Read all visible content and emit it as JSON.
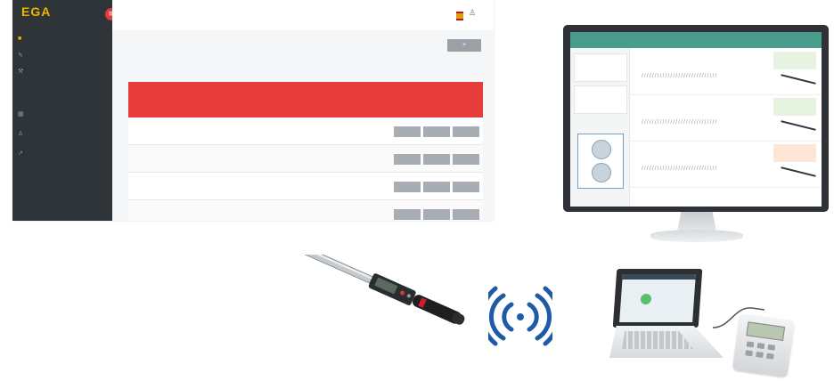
{
  "webapp": {
    "logo_line1": "EGA",
    "logo_line2": "",
    "badge": "≡",
    "nav": [
      {
        "label": "",
        "icon": "dashboard-icon"
      },
      {
        "label": "",
        "icon": "wrench-icon"
      },
      {
        "label": "",
        "icon": "tools-icon"
      }
    ],
    "nav_section": "",
    "nav_section_items": [
      {
        "label": "",
        "icon": "calendar-icon"
      },
      {
        "label": "",
        "icon": "user-icon"
      },
      {
        "label": "",
        "icon": "chart-icon"
      }
    ],
    "user_name": "",
    "add_button": "+",
    "crumb": "",
    "crumb_right": "",
    "table": {
      "headers": [
        "",
        "",
        "",
        "",
        ""
      ],
      "rows": [
        {
          "id": "",
          "status": "",
          "date": "",
          "buttons": [
            "",
            "",
            ""
          ]
        },
        {
          "id": "",
          "status": "",
          "date": "",
          "buttons": [
            "",
            "",
            ""
          ]
        },
        {
          "id": "",
          "status": "",
          "date": "",
          "buttons": [
            "",
            "",
            ""
          ]
        },
        {
          "id": "",
          "status": "",
          "date": "",
          "buttons": [
            "",
            "",
            ""
          ]
        }
      ]
    },
    "colors": {
      "sidebar": "#2f3438",
      "table_header": "#e73c3c",
      "logo": "#f0b400"
    }
  },
  "monitor": {
    "title": "",
    "right": "",
    "cards": [
      {
        "k": "",
        "v": ""
      },
      {
        "k": "",
        "v": ""
      }
    ],
    "card_label": "",
    "rows": [
      {
        "code": "",
        "label": "",
        "val": "",
        "tag": "",
        "tag_color": "#e6f3e0"
      },
      {
        "code": "",
        "label": "",
        "val": "",
        "tag": "",
        "tag_color": "#e6f3e0"
      },
      {
        "code": "",
        "label": "",
        "val": "",
        "tag": "",
        "tag_color": "#fde6d6"
      }
    ],
    "header_color": "#4a9c8c"
  },
  "wifi_icon": "wireless-signal-icon"
}
